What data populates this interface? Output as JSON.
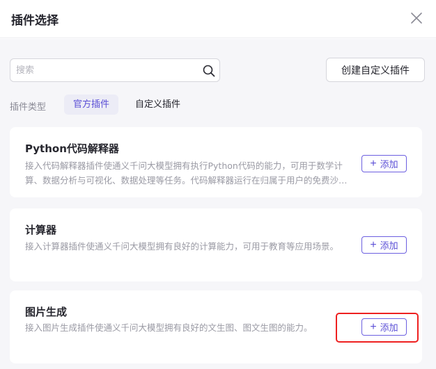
{
  "dialog": {
    "title": "插件选择"
  },
  "search": {
    "placeholder": "搜索"
  },
  "toolbar": {
    "create_label": "创建自定义插件"
  },
  "filter": {
    "label": "插件类型",
    "tabs": [
      {
        "label": "官方插件",
        "active": true
      },
      {
        "label": "自定义插件",
        "active": false
      }
    ]
  },
  "plugins": [
    {
      "name": "Python代码解释器",
      "description": "接入代码解释器插件使通义千问大模型拥有执行Python代码的能力，可用于数学计算、数据分析与可视化、数据处理等任务。代码解释器运行在归属于用户的免费沙箱环境中",
      "add_label": "添加"
    },
    {
      "name": "计算器",
      "description": "接入计算器插件使通义千问大模型拥有良好的计算能力，可用于教育等应用场景。",
      "add_label": "添加"
    },
    {
      "name": "图片生成",
      "description": "接入图片生成插件使通义千问大模型拥有良好的文生图、图文生图的能力。",
      "add_label": "添加"
    }
  ],
  "icons": {
    "close": "close-icon",
    "search": "search-icon",
    "plus": "plus-icon"
  },
  "colors": {
    "accent": "#5b4fd6",
    "highlight": "#ee2020"
  }
}
